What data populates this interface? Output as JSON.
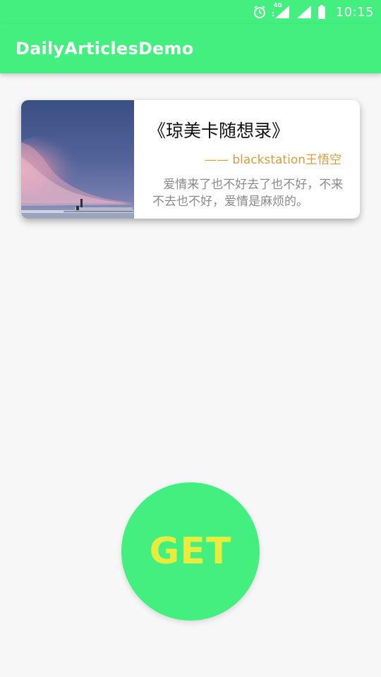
{
  "status_bar": {
    "time": "10:15",
    "network": "4G",
    "icons": [
      "alarm-icon",
      "signal-4g-icon",
      "signal-icon",
      "battery-icon"
    ]
  },
  "app_bar": {
    "title": "DailyArticlesDemo"
  },
  "article_card": {
    "image": "sky-photo",
    "title": "《琼美卡随想录》",
    "author": "—— blackstation王悟空",
    "excerpt": "爱情来了也不好去了也不好，不来不去也不好，爱情是麻烦的。"
  },
  "get_button": {
    "label": "GET"
  },
  "colors": {
    "primary": "#43ef7e",
    "get_label": "#e9ec3c",
    "author": "#d79b3e",
    "excerpt": "#8a8a8a",
    "background": "#f7f7f7"
  }
}
